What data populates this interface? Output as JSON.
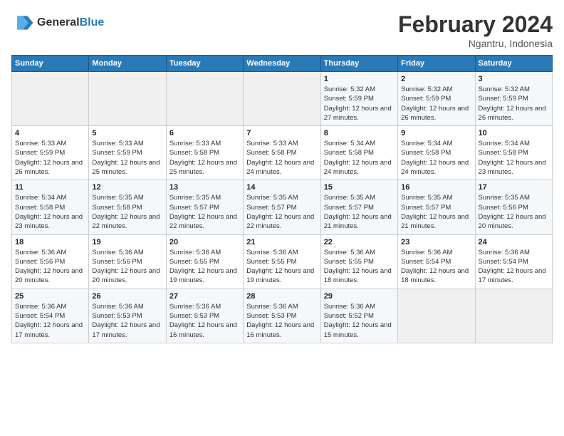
{
  "header": {
    "logo_general": "General",
    "logo_blue": "Blue",
    "month_title": "February 2024",
    "location": "Ngantru, Indonesia"
  },
  "days_of_week": [
    "Sunday",
    "Monday",
    "Tuesday",
    "Wednesday",
    "Thursday",
    "Friday",
    "Saturday"
  ],
  "weeks": [
    [
      {
        "day": "",
        "info": ""
      },
      {
        "day": "",
        "info": ""
      },
      {
        "day": "",
        "info": ""
      },
      {
        "day": "",
        "info": ""
      },
      {
        "day": "1",
        "info": "Sunrise: 5:32 AM\nSunset: 5:59 PM\nDaylight: 12 hours and 27 minutes."
      },
      {
        "day": "2",
        "info": "Sunrise: 5:32 AM\nSunset: 5:59 PM\nDaylight: 12 hours and 26 minutes."
      },
      {
        "day": "3",
        "info": "Sunrise: 5:32 AM\nSunset: 5:59 PM\nDaylight: 12 hours and 26 minutes."
      }
    ],
    [
      {
        "day": "4",
        "info": "Sunrise: 5:33 AM\nSunset: 5:59 PM\nDaylight: 12 hours and 26 minutes."
      },
      {
        "day": "5",
        "info": "Sunrise: 5:33 AM\nSunset: 5:59 PM\nDaylight: 12 hours and 25 minutes."
      },
      {
        "day": "6",
        "info": "Sunrise: 5:33 AM\nSunset: 5:58 PM\nDaylight: 12 hours and 25 minutes."
      },
      {
        "day": "7",
        "info": "Sunrise: 5:33 AM\nSunset: 5:58 PM\nDaylight: 12 hours and 24 minutes."
      },
      {
        "day": "8",
        "info": "Sunrise: 5:34 AM\nSunset: 5:58 PM\nDaylight: 12 hours and 24 minutes."
      },
      {
        "day": "9",
        "info": "Sunrise: 5:34 AM\nSunset: 5:58 PM\nDaylight: 12 hours and 24 minutes."
      },
      {
        "day": "10",
        "info": "Sunrise: 5:34 AM\nSunset: 5:58 PM\nDaylight: 12 hours and 23 minutes."
      }
    ],
    [
      {
        "day": "11",
        "info": "Sunrise: 5:34 AM\nSunset: 5:58 PM\nDaylight: 12 hours and 23 minutes."
      },
      {
        "day": "12",
        "info": "Sunrise: 5:35 AM\nSunset: 5:58 PM\nDaylight: 12 hours and 22 minutes."
      },
      {
        "day": "13",
        "info": "Sunrise: 5:35 AM\nSunset: 5:57 PM\nDaylight: 12 hours and 22 minutes."
      },
      {
        "day": "14",
        "info": "Sunrise: 5:35 AM\nSunset: 5:57 PM\nDaylight: 12 hours and 22 minutes."
      },
      {
        "day": "15",
        "info": "Sunrise: 5:35 AM\nSunset: 5:57 PM\nDaylight: 12 hours and 21 minutes."
      },
      {
        "day": "16",
        "info": "Sunrise: 5:35 AM\nSunset: 5:57 PM\nDaylight: 12 hours and 21 minutes."
      },
      {
        "day": "17",
        "info": "Sunrise: 5:35 AM\nSunset: 5:56 PM\nDaylight: 12 hours and 20 minutes."
      }
    ],
    [
      {
        "day": "18",
        "info": "Sunrise: 5:36 AM\nSunset: 5:56 PM\nDaylight: 12 hours and 20 minutes."
      },
      {
        "day": "19",
        "info": "Sunrise: 5:36 AM\nSunset: 5:56 PM\nDaylight: 12 hours and 20 minutes."
      },
      {
        "day": "20",
        "info": "Sunrise: 5:36 AM\nSunset: 5:55 PM\nDaylight: 12 hours and 19 minutes."
      },
      {
        "day": "21",
        "info": "Sunrise: 5:36 AM\nSunset: 5:55 PM\nDaylight: 12 hours and 19 minutes."
      },
      {
        "day": "22",
        "info": "Sunrise: 5:36 AM\nSunset: 5:55 PM\nDaylight: 12 hours and 18 minutes."
      },
      {
        "day": "23",
        "info": "Sunrise: 5:36 AM\nSunset: 5:54 PM\nDaylight: 12 hours and 18 minutes."
      },
      {
        "day": "24",
        "info": "Sunrise: 5:36 AM\nSunset: 5:54 PM\nDaylight: 12 hours and 17 minutes."
      }
    ],
    [
      {
        "day": "25",
        "info": "Sunrise: 5:36 AM\nSunset: 5:54 PM\nDaylight: 12 hours and 17 minutes."
      },
      {
        "day": "26",
        "info": "Sunrise: 5:36 AM\nSunset: 5:53 PM\nDaylight: 12 hours and 17 minutes."
      },
      {
        "day": "27",
        "info": "Sunrise: 5:36 AM\nSunset: 5:53 PM\nDaylight: 12 hours and 16 minutes."
      },
      {
        "day": "28",
        "info": "Sunrise: 5:36 AM\nSunset: 5:53 PM\nDaylight: 12 hours and 16 minutes."
      },
      {
        "day": "29",
        "info": "Sunrise: 5:36 AM\nSunset: 5:52 PM\nDaylight: 12 hours and 15 minutes."
      },
      {
        "day": "",
        "info": ""
      },
      {
        "day": "",
        "info": ""
      }
    ]
  ]
}
